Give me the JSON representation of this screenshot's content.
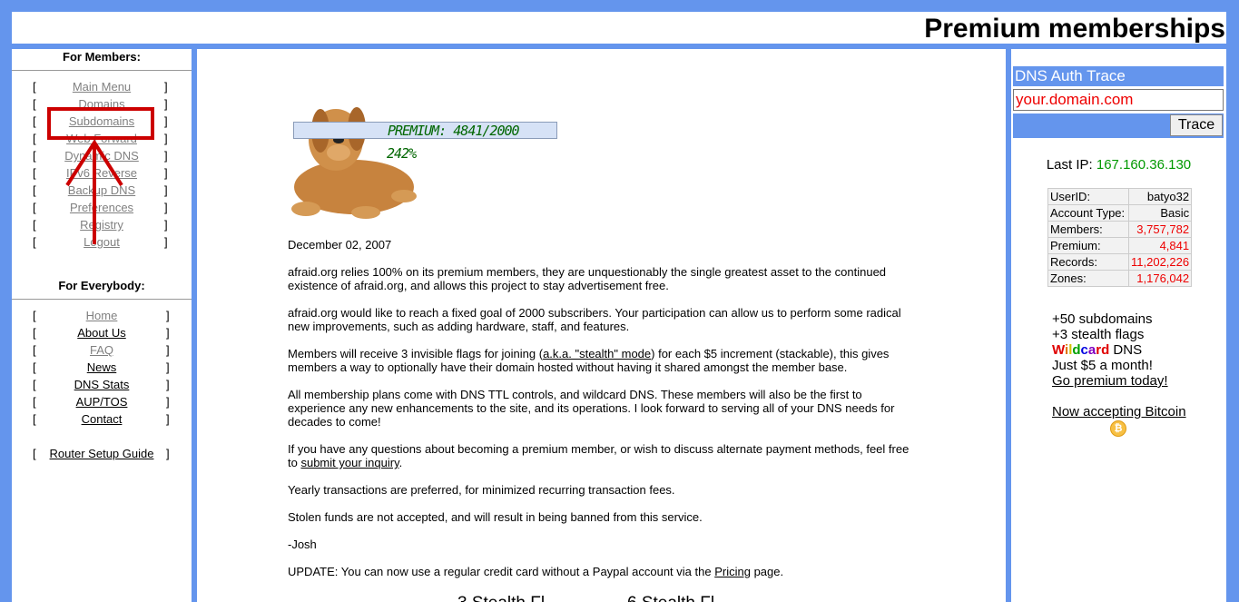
{
  "header": {
    "title": "Premium memberships"
  },
  "members": {
    "title": "For Members:",
    "items": [
      {
        "label": "Main Menu",
        "style": "gray"
      },
      {
        "label": "Domains",
        "style": "gray"
      },
      {
        "label": "Subdomains",
        "style": "gray"
      },
      {
        "label": "Web Forward",
        "style": "gray"
      },
      {
        "label": "Dynamic DNS",
        "style": "gray"
      },
      {
        "label": "IPv6 Reverse",
        "style": "gray"
      },
      {
        "label": "Backup DNS",
        "style": "gray"
      },
      {
        "label": "Preferences",
        "style": "gray"
      },
      {
        "label": "Registry",
        "style": "gray"
      },
      {
        "label": "Logout",
        "style": "gray"
      }
    ]
  },
  "everybody": {
    "title": "For Everybody:",
    "items": [
      {
        "label": "Home",
        "style": "gray"
      },
      {
        "label": "About Us",
        "style": "blk"
      },
      {
        "label": "FAQ",
        "style": "gray"
      },
      {
        "label": "News",
        "style": "blk"
      },
      {
        "label": "DNS Stats",
        "style": "blk"
      },
      {
        "label": "AUP/TOS",
        "style": "blk"
      },
      {
        "label": "Contact",
        "style": "blk"
      }
    ],
    "router": "Router Setup Guide"
  },
  "brackets": {
    "left": "[",
    "right": "]"
  },
  "premium_banner": {
    "text": "PREMIUM: 4841/2000",
    "percent": "242%",
    "progress": 1.0
  },
  "main": {
    "date": "December 02, 2007",
    "p1": "afraid.org relies 100% on its premium members, they are unquestionably the single greatest asset to the continued existence of afraid.org, and allows this project to stay advertisement free.",
    "p2": "afraid.org would like to reach a fixed goal of 2000 subscribers.   Your participation can allow us to perform some radical new improvements, such as adding hardware, staff, and features.",
    "p3_a": "Members will receive 3 invisible flags for joining (",
    "p3_link": "a.k.a. \"stealth\" mode",
    "p3_b": ") for each $5 increment (stackable), this gives members a way to optionally have their domain hosted without having it shared amongst the member base.",
    "p4": "All membership plans come with DNS TTL controls, and wildcard DNS. These members will also be the first to experience any new enhancements to the site, and its operations. I look forward to serving all of your DNS needs for decades to come!",
    "p5_a": "If you have any questions about becoming a premium member, or wish to discuss alternate payment methods, feel free to ",
    "p5_link": "submit your inquiry",
    "p5_b": ".",
    "p6": "Yearly transactions are preferred, for minimized recurring transaction fees.",
    "p7": "Stolen funds are not accepted, and will result in being banned from this service.",
    "p8": "-Josh",
    "p9_a": "UPDATE: You can now use a regular credit card without a Paypal account via the ",
    "p9_link": "Pricing",
    "p9_b": " page.",
    "cut_a": "3 Stealth Fl",
    "cut_b": "6 Stealth Fl"
  },
  "dns_trace": {
    "title": "DNS Auth Trace",
    "value": "your.domain.com",
    "button": "Trace"
  },
  "last_ip": {
    "label": "Last IP:",
    "value": "167.160.36.130"
  },
  "stats": [
    {
      "label": "UserID:",
      "value": "batyo32"
    },
    {
      "label": "Account Type:",
      "value": "Basic"
    },
    {
      "label": "Members:",
      "value": "3,757,782"
    },
    {
      "label": "Premium:",
      "value": "4,841"
    },
    {
      "label": "Records:",
      "value": "11,202,226"
    },
    {
      "label": "Zones:",
      "value": "1,176,042"
    }
  ],
  "promo": {
    "l1": "+50 subdomains",
    "l2": "+3 stealth flags",
    "wildcard": "Wildcard",
    "dns": " DNS",
    "l4": "Just $5 a month!",
    "link": "Go premium today!",
    "bitcoin": "Now accepting Bitcoin",
    "bitcoin_symbol": "₿"
  },
  "colors": {
    "accent": "#6495ED",
    "link_gray": "#808080",
    "annotation_red": "#cc0000",
    "stat_red": "#e00000",
    "ip_green": "#009900"
  }
}
